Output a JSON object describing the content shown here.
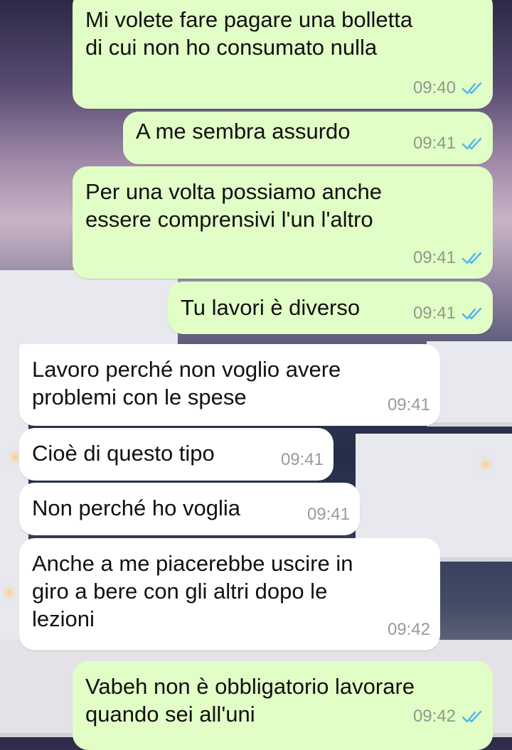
{
  "messages": [
    {
      "direction": "out",
      "text": "Mi volete fare pagare una bolletta\ndi cui non ho consumato nulla",
      "time": "09:40",
      "status": "read"
    },
    {
      "direction": "out",
      "text": "A me sembra assurdo",
      "time": "09:41",
      "status": "read"
    },
    {
      "direction": "out",
      "text": "Per una volta possiamo anche\nessere comprensivi l'un l'altro",
      "time": "09:41",
      "status": "read"
    },
    {
      "direction": "out",
      "text": "Tu lavori è diverso",
      "time": "09:41",
      "status": "read"
    },
    {
      "direction": "in",
      "text": "Lavoro perché non voglio avere\nproblemi con le spese",
      "time": "09:41"
    },
    {
      "direction": "in",
      "text": "Cioè di questo tipo",
      "time": "09:41"
    },
    {
      "direction": "in",
      "text": "Non perché ho voglia",
      "time": "09:41"
    },
    {
      "direction": "in",
      "text": "Anche a me piacerebbe uscire in\ngiro a bere con gli altri dopo le\nlezioni",
      "time": "09:42"
    },
    {
      "direction": "out",
      "text": "Vabeh non è obbligatorio lavorare\nquando sei all'uni",
      "time": "09:42",
      "status": "read"
    }
  ],
  "colors": {
    "outgoing": "#e1fec6",
    "incoming": "#ffffff",
    "read_ticks": "#4fb6ec"
  },
  "icons": {
    "read_receipt": "double-check-icon"
  }
}
